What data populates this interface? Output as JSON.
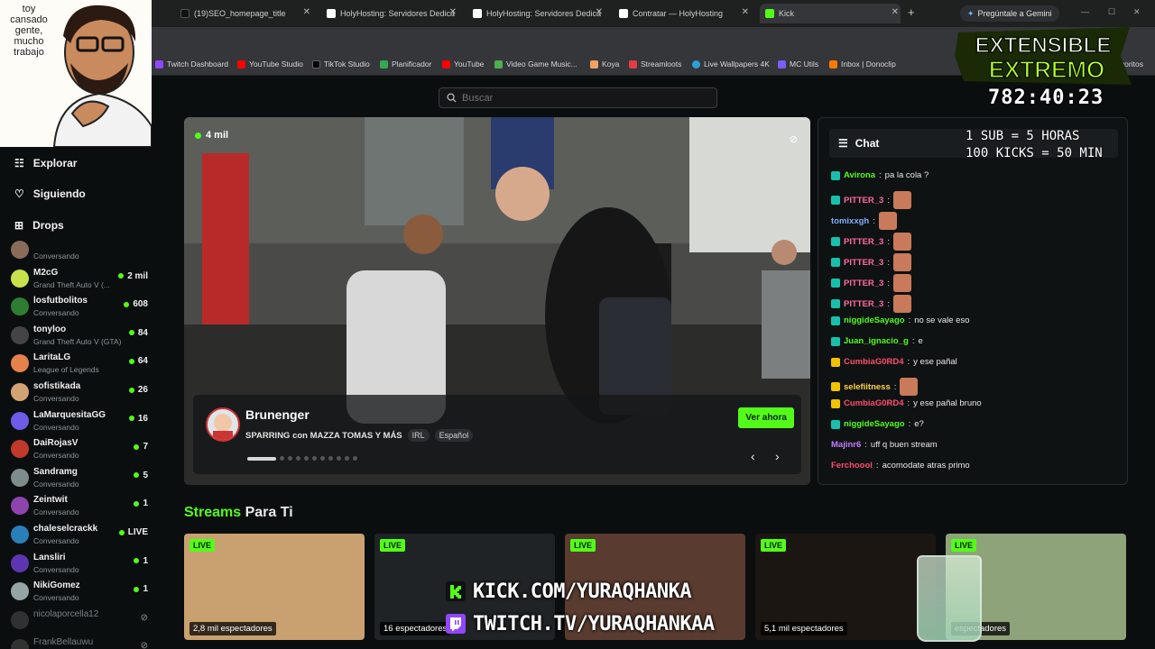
{
  "browser": {
    "tabs": [
      {
        "label": "(19)SEO_homepage_title",
        "fav_color": "#111111"
      },
      {
        "label": "HolyHosting: Servidores Dedica",
        "fav_color": "#ffffff"
      },
      {
        "label": "HolyHosting: Servidores Dedica",
        "fav_color": "#ffffff"
      },
      {
        "label": "Contratar — HolyHosting",
        "fav_color": "#ffffff"
      },
      {
        "label": "Kick",
        "fav_color": "#53fc18"
      }
    ],
    "gemini_label": "Pregúntale a Gemini",
    "bookmarks": [
      {
        "label": "Twitch Dashboard",
        "color": "#9146ff"
      },
      {
        "label": "YouTube Studio",
        "color": "#ff0000"
      },
      {
        "label": "TikTok Studio",
        "color": "#000000"
      },
      {
        "label": "Planificador",
        "color": "#34a853"
      },
      {
        "label": "YouTube",
        "color": "#ff0000"
      },
      {
        "label": "Video Game Music...",
        "color": "#4caf50"
      },
      {
        "label": "Koya",
        "color": "#f4a261"
      },
      {
        "label": "Streamloots",
        "color": "#e63946"
      },
      {
        "label": "Live Wallpapers 4K",
        "color": "#2aa1d6"
      },
      {
        "label": "MC Utils",
        "color": "#7a5cff"
      },
      {
        "label": "Inbox | Donoclip",
        "color": "#ff7a00"
      },
      {
        "label": "Favoritos",
        "color": "#888888"
      }
    ]
  },
  "search": {
    "placeholder": "Buscar"
  },
  "sidebar": {
    "nav": [
      {
        "label": "Explorar"
      },
      {
        "label": "Siguiendo"
      },
      {
        "label": "Drops"
      }
    ],
    "following": [
      {
        "name": "",
        "category": "Conversando",
        "viewers": "",
        "color": "#8a6b5a"
      },
      {
        "name": "M2cG",
        "category": "Grand Theft Auto V (...",
        "viewers": "2 mil",
        "color": "#c8e04a"
      },
      {
        "name": "losfutbolitos",
        "category": "Conversando",
        "viewers": "608",
        "color": "#2e7d32"
      },
      {
        "name": "tonyloo",
        "category": "Grand Theft Auto V (GTA)",
        "viewers": "84",
        "color": "#444"
      },
      {
        "name": "LaritaLG",
        "category": "League of Legends",
        "viewers": "64",
        "color": "#e5814a"
      },
      {
        "name": "sofistikada",
        "category": "Conversando",
        "viewers": "26",
        "color": "#d4a373"
      },
      {
        "name": "LaMarquesitaGG",
        "category": "Conversando",
        "viewers": "16",
        "color": "#6c5ce7"
      },
      {
        "name": "DaiRojasV",
        "category": "Conversando",
        "viewers": "7",
        "color": "#c0392b"
      },
      {
        "name": "Sandramg",
        "category": "Conversando",
        "viewers": "5",
        "color": "#7f8c8d"
      },
      {
        "name": "Zeintwit",
        "category": "Conversando",
        "viewers": "1",
        "color": "#8e44ad"
      },
      {
        "name": "chaleselcrackk",
        "category": "Conversando",
        "viewers": "LIVE",
        "color": "#2980b9"
      },
      {
        "name": "Lansliri",
        "category": "Conversando",
        "viewers": "1",
        "color": "#5e35b1"
      },
      {
        "name": "NikiGomez",
        "category": "Conversando",
        "viewers": "1",
        "color": "#95a5a6"
      },
      {
        "name": "nicolaporcella12",
        "category": "",
        "viewers": "",
        "color": "#555"
      },
      {
        "name": "FrankBellauwu",
        "category": "",
        "viewers": "",
        "color": "#555"
      }
    ]
  },
  "featured": {
    "viewers": "4 mil",
    "channel": "Brunenger",
    "title": "SPARRING con MAZZA TOMAS Y MÁS",
    "tags": [
      "IRL",
      "Español"
    ],
    "watch_label": "Ver ahora",
    "carousel_total": 11,
    "carousel_active": 0
  },
  "chat": {
    "title": "Chat",
    "messages": [
      {
        "user": "Avirona",
        "text": "pa la cola ?",
        "color": "#53fc18",
        "badge": "#18c0ac",
        "emote": false
      },
      {
        "user": "PITTER_3",
        "text": "",
        "color": "#ff6b9a",
        "badge": "#18c0ac",
        "emote": true
      },
      {
        "user": "tomixxgh",
        "text": "",
        "color": "#7fb0ff",
        "badge": "",
        "emote": true
      },
      {
        "user": "PITTER_3",
        "text": "",
        "color": "#ff6b9a",
        "badge": "#18c0ac",
        "emote": true
      },
      {
        "user": "PITTER_3",
        "text": "",
        "color": "#ff6b9a",
        "badge": "#18c0ac",
        "emote": true
      },
      {
        "user": "PITTER_3",
        "text": "",
        "color": "#ff6b9a",
        "badge": "#18c0ac",
        "emote": true
      },
      {
        "user": "PITTER_3",
        "text": "",
        "color": "#ff6b9a",
        "badge": "#18c0ac",
        "emote": true
      },
      {
        "user": "niggideSayago",
        "text": "no se vale eso",
        "color": "#53fc18",
        "badge": "#18c0ac",
        "emote": false
      },
      {
        "user": "Juan_ignacio_g",
        "text": "e",
        "color": "#53fc18",
        "badge": "#18c0ac",
        "emote": false
      },
      {
        "user": "CumbiaG0RD4",
        "text": "y ese pañal",
        "color": "#ff4d6d",
        "badge": "#f2c200",
        "emote": false
      },
      {
        "user": "selefiitness",
        "text": "",
        "color": "#ffd23f",
        "badge": "#f2c200",
        "emote": true
      },
      {
        "user": "CumbiaG0RD4",
        "text": "y ese pañal bruno",
        "color": "#ff4d6d",
        "badge": "#f2c200",
        "emote": false
      },
      {
        "user": "niggideSayago",
        "text": "e?",
        "color": "#53fc18",
        "badge": "#18c0ac",
        "emote": false
      },
      {
        "user": "Majinr6",
        "text": "uff q buen stream",
        "color": "#c77dff",
        "badge": "",
        "emote": false
      },
      {
        "user": "Ferchoool",
        "text": "acomodate atras primo",
        "color": "#ff4d6d",
        "badge": "",
        "emote": false
      }
    ]
  },
  "streams": {
    "title_green": "Streams",
    "title_white": "Para Ti",
    "live_label": "LIVE",
    "items": [
      {
        "viewers": "2,8 mil espectadores",
        "color": "#c9a06f"
      },
      {
        "viewers": "16 espectadores",
        "color": "#1f2326"
      },
      {
        "viewers": "",
        "color": "#5a3b2f"
      },
      {
        "viewers": "5,1 mil espectadores",
        "color": "#1c1612"
      },
      {
        "viewers": "espectadores",
        "color": "#8fa37a"
      }
    ]
  },
  "overlay": {
    "meme_text": "toy cansado gente, mucho trabajo",
    "logo_line1": "EXTENSIBLE",
    "logo_line2": "EXTREMO",
    "timer": "782:40:23",
    "goal1": "1 SUB = 5 HORAS",
    "goal2": "100 KICKS = 50 MIN",
    "kick_url": "KICK.COM/YURAQHANKA",
    "twitch_url": "TWITCH.TV/YURAQHANKAA"
  }
}
